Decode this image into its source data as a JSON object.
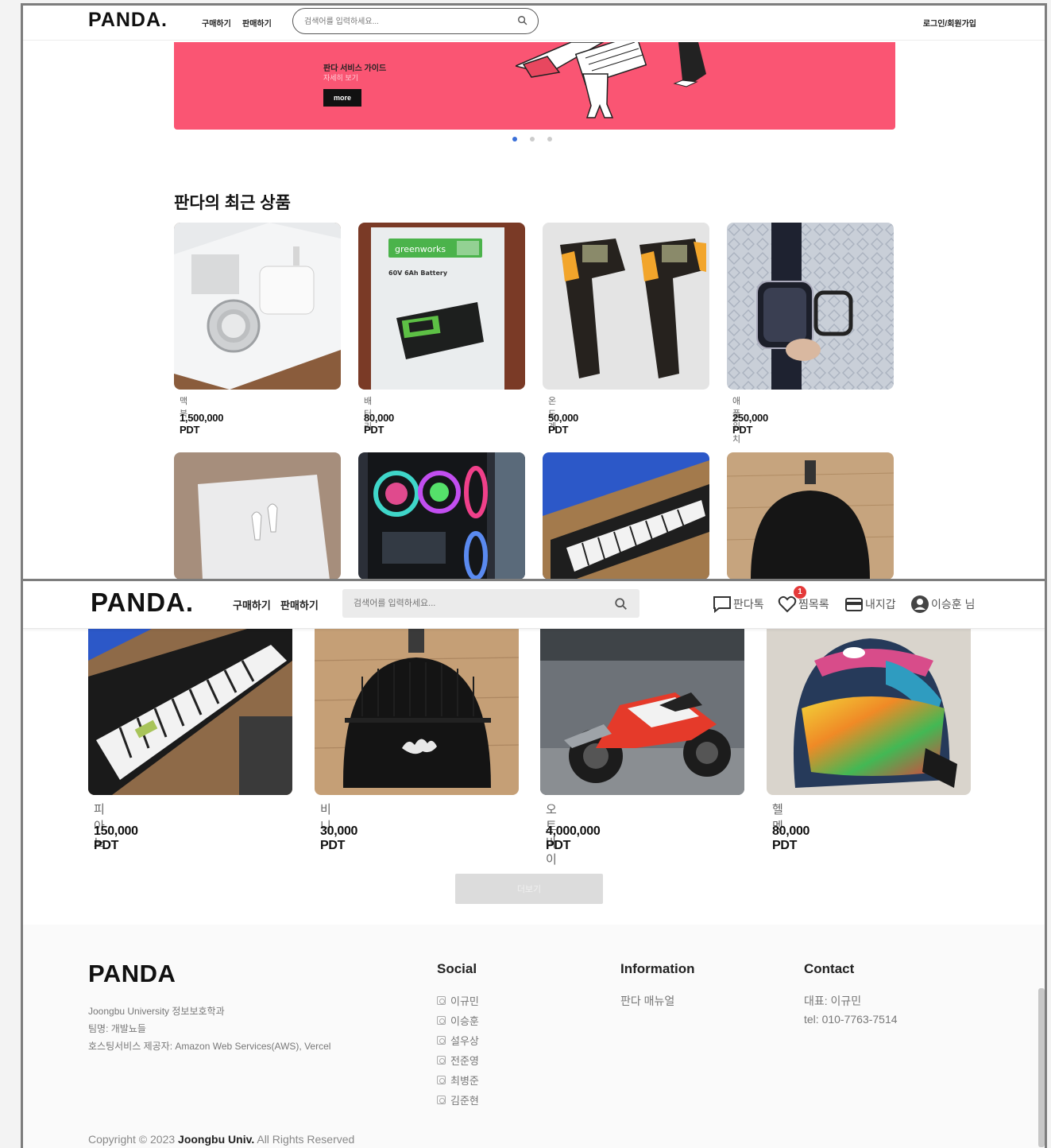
{
  "top_view": {
    "header": {
      "logo": "PANDA.",
      "nav": [
        {
          "label": "구매하기"
        },
        {
          "label": "판매하기"
        }
      ],
      "search_placeholder": "검색어를 입력하세요...",
      "login_label": "로그인/회원가입"
    },
    "banner": {
      "title": "판다 서비스 가이드",
      "link": "자세히 보기",
      "more_label": "more",
      "bg_color": "#fa5573",
      "slide_count": 3,
      "active_slide": 1
    },
    "section_title": "판다의 최근 상품",
    "products": [
      {
        "name": "맥북",
        "price": "1,500,000 PDT",
        "image": "charger-box"
      },
      {
        "name": "배터리",
        "price": "80,000 PDT",
        "image": "battery-pack"
      },
      {
        "name": "온도계",
        "price": "50,000 PDT",
        "image": "thermometer-guns"
      },
      {
        "name": "애플워치",
        "price": "250,000 PDT",
        "image": "smartwatch"
      }
    ],
    "partial_row_images": [
      "airpods",
      "gaming-pc",
      "keyboard-piano",
      "beanie"
    ]
  },
  "bottom_view": {
    "header": {
      "logo": "PANDA.",
      "nav": [
        {
          "label": "구매하기"
        },
        {
          "label": "판매하기"
        }
      ],
      "search_placeholder": "검색어를 입력하세요...",
      "chat_label": "판다톡",
      "wishlist_label": "찜목록",
      "wishlist_badge": "1",
      "wallet_label": "내지갑",
      "user_label": "이승훈 님"
    },
    "products": [
      {
        "name": "피아노",
        "price": "150,000 PDT",
        "image": "keyboard-piano"
      },
      {
        "name": "비니",
        "price": "30,000 PDT",
        "image": "beanie"
      },
      {
        "name": "오토바이",
        "price": "4,000,000 PDT",
        "image": "motorcycle"
      },
      {
        "name": "헬멧",
        "price": "80,000 PDT",
        "image": "helmet"
      }
    ],
    "more_button": "더보기"
  },
  "footer": {
    "logo": "PANDA",
    "address_lines": [
      "Joongbu University 정보보호학과",
      "팀명: 개발뇨들",
      "호스팅서비스 제공자: Amazon Web Services(AWS), Vercel"
    ],
    "social": {
      "title": "Social",
      "items": [
        "이규민",
        "이승훈",
        "설우상",
        "전준영",
        "최병준",
        "김준현"
      ]
    },
    "information": {
      "title": "Information",
      "items": [
        "판다 매뉴얼"
      ]
    },
    "contact": {
      "title": "Contact",
      "items": [
        "대표: 이규민",
        "tel: 010-7763-7514"
      ]
    },
    "copyright_prefix": "Copyright © 2023",
    "copyright_owner": "Joongbu Univ.",
    "copyright_suffix": "All Rights Reserved"
  }
}
